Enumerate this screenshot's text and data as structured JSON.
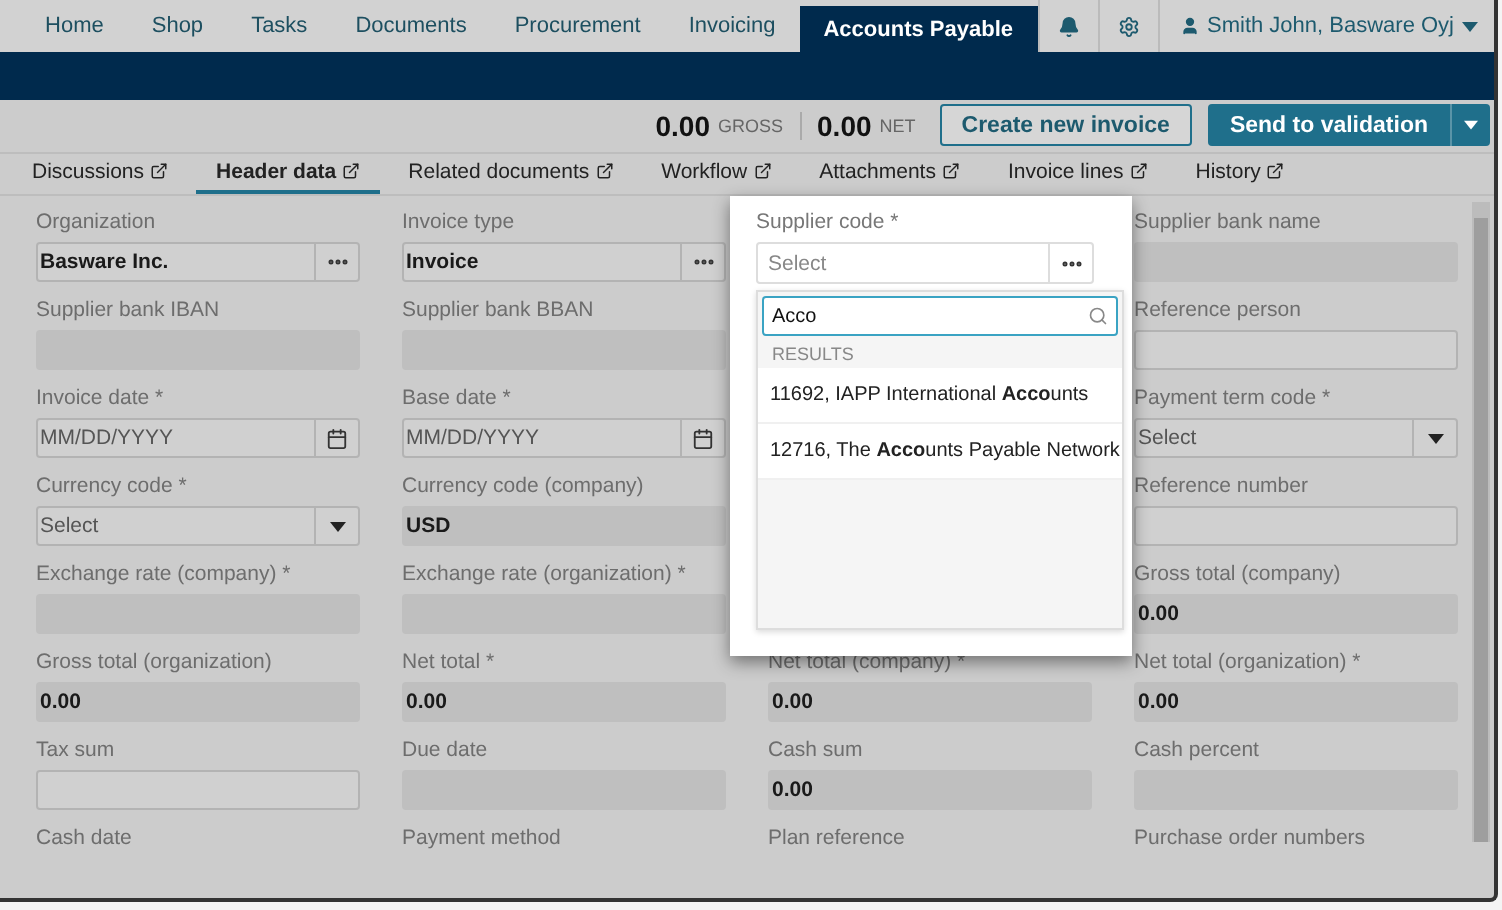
{
  "nav": {
    "items": [
      {
        "label": "Home",
        "selected": false
      },
      {
        "label": "Shop",
        "selected": false
      },
      {
        "label": "Tasks",
        "selected": false
      },
      {
        "label": "Documents",
        "selected": false
      },
      {
        "label": "Procurement",
        "selected": false
      },
      {
        "label": "Invoicing",
        "selected": false
      },
      {
        "label": "Accounts Payable",
        "selected": true
      }
    ],
    "user": "Smith John, Basware Oyj"
  },
  "toolbar": {
    "gross": "0.00",
    "gross_label": "GROSS",
    "net": "0.00",
    "net_label": "NET",
    "create_button": "Create new invoice",
    "send_button": "Send to validation"
  },
  "tabs": [
    {
      "label": "Discussions",
      "selected": false
    },
    {
      "label": "Header data",
      "selected": true
    },
    {
      "label": "Related documents",
      "selected": false
    },
    {
      "label": "Workflow",
      "selected": false
    },
    {
      "label": "Attachments",
      "selected": false
    },
    {
      "label": "Invoice lines",
      "selected": false
    },
    {
      "label": "History",
      "selected": false
    }
  ],
  "supplier_popup": {
    "label": "Supplier code *",
    "placeholder": "Select",
    "search": "Acco",
    "results_heading": "RESULTS",
    "results": [
      "11692, IAPP International **Acco**unts",
      "12716, The **Acco**unts Payable Network"
    ]
  },
  "fields": [
    {
      "label": "Organization",
      "kind": "lookup",
      "value": "Basware Inc."
    },
    {
      "label": "Invoice type",
      "kind": "lookup",
      "value": "Invoice"
    },
    {
      "label": "Supplier bank name",
      "kind": "readonly"
    },
    {
      "label": "Supplier bank IBAN",
      "kind": "readonly"
    },
    {
      "label": "Supplier bank BBAN",
      "kind": "readonly"
    },
    {
      "label": "Reference person",
      "kind": "input"
    },
    {
      "label": "Invoice date *",
      "kind": "date",
      "placeholder": "MM/DD/YYYY"
    },
    {
      "label": "Base date *",
      "kind": "date",
      "placeholder": "MM/DD/YYYY"
    },
    {
      "label": "Payment term code *",
      "kind": "select",
      "placeholder": "Select"
    },
    {
      "label": "Currency code *",
      "kind": "select",
      "placeholder": "Select"
    },
    {
      "label": "Currency code (company)",
      "kind": "readonly",
      "value": "USD"
    },
    {
      "label": "Reference number",
      "kind": "input"
    },
    {
      "label": "Exchange rate (company) *",
      "kind": "readonly"
    },
    {
      "label": "Exchange rate (organization) *",
      "kind": "readonly"
    },
    {
      "label": "Gross total (company)",
      "kind": "readonly",
      "value": "0.00"
    },
    {
      "label": "Gross total (organization)",
      "kind": "readonly",
      "value": "0.00"
    },
    {
      "label": "Net total *",
      "kind": "readonly",
      "value": "0.00"
    },
    {
      "label": "Net total (company) *",
      "kind": "readonly",
      "value": "0.00"
    },
    {
      "label": "Net total (organization) *",
      "kind": "readonly",
      "value": "0.00"
    },
    {
      "label": "Tax sum",
      "kind": "input"
    },
    {
      "label": "Due date",
      "kind": "readonly"
    },
    {
      "label": "Cash sum",
      "kind": "readonly",
      "value": "0.00"
    },
    {
      "label": "Cash percent",
      "kind": "readonly"
    },
    {
      "label": "Cash date",
      "kind": "label"
    },
    {
      "label": "Payment method",
      "kind": "label"
    },
    {
      "label": "Plan reference",
      "kind": "label"
    },
    {
      "label": "Purchase order numbers",
      "kind": "label"
    }
  ]
}
